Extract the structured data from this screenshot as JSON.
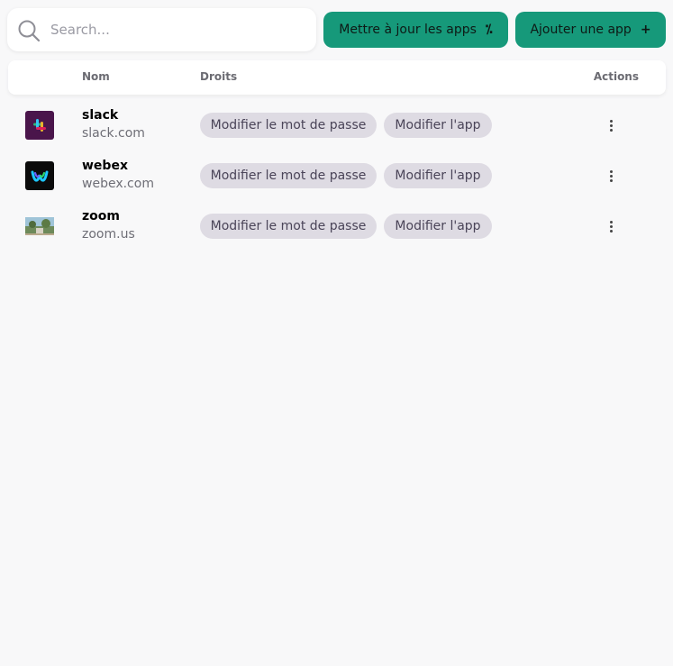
{
  "search": {
    "placeholder": "Search..."
  },
  "toolbar": {
    "update_label": "Mettre à jour les apps",
    "update_glyph": "⁒",
    "add_label": "Ajouter une app",
    "add_glyph": "+"
  },
  "table": {
    "columns": {
      "name": "Nom",
      "rights": "Droits",
      "actions": "Actions"
    },
    "rows": [
      {
        "name": "slack",
        "domain": "slack.com",
        "icon": "slack-logo-icon",
        "rights": [
          "Modifier le mot de passe",
          "Modifier l'app"
        ]
      },
      {
        "name": "webex",
        "domain": "webex.com",
        "icon": "webex-logo-icon",
        "rights": [
          "Modifier le mot de passe",
          "Modifier l'app"
        ]
      },
      {
        "name": "zoom",
        "domain": "zoom.us",
        "icon": "zoom-thumbnail-icon",
        "rights": [
          "Modifier le mot de passe",
          "Modifier l'app"
        ]
      }
    ]
  },
  "colors": {
    "accent": "#16997a",
    "chip_bg": "#dedbe3",
    "page_bg": "#f8f8f9"
  }
}
